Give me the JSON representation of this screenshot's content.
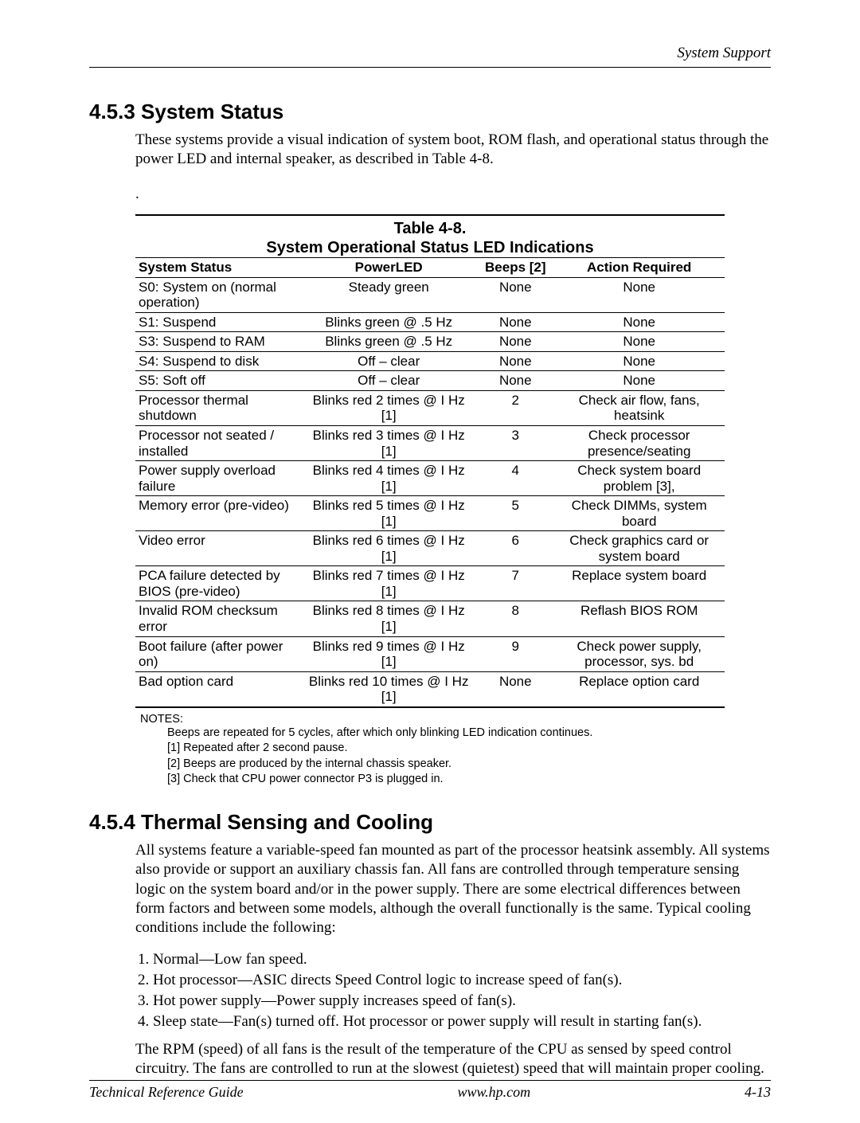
{
  "header": {
    "right": "System Support"
  },
  "section1": {
    "heading": "4.5.3 System Status",
    "para": "These systems provide a visual indication of system boot, ROM flash, and operational status through the power LED and internal speaker, as described in Table 4-8."
  },
  "table": {
    "caption_l1": "Table 4-8.",
    "caption_l2": "System Operational Status LED Indications",
    "headers": {
      "status": "System Status",
      "power": "PowerLED",
      "beeps": "Beeps [2]",
      "action": "Action Required"
    },
    "rows": [
      {
        "status": "S0: System on (normal operation)",
        "power": "Steady green",
        "beeps": "None",
        "action": "None"
      },
      {
        "status": "S1: Suspend",
        "power": "Blinks green @ .5 Hz",
        "beeps": "None",
        "action": "None"
      },
      {
        "status": "S3: Suspend to RAM",
        "power": "Blinks green @ .5 Hz",
        "beeps": "None",
        "action": "None"
      },
      {
        "status": "S4: Suspend to disk",
        "power": "Off – clear",
        "beeps": "None",
        "action": "None"
      },
      {
        "status": "S5: Soft off",
        "power": "Off – clear",
        "beeps": "None",
        "action": "None"
      },
      {
        "status": "Processor thermal shutdown",
        "power": "Blinks red 2 times @ I Hz [1]",
        "beeps": "2",
        "action": "Check air flow, fans, heatsink"
      },
      {
        "status": "Processor not seated / installed",
        "power": "Blinks red 3 times @ I Hz [1]",
        "beeps": "3",
        "action": "Check processor presence/seating"
      },
      {
        "status": "Power supply overload failure",
        "power": "Blinks red 4 times @ I Hz [1]",
        "beeps": "4",
        "action": "Check system board problem [3],"
      },
      {
        "status": "Memory error (pre-video)",
        "power": "Blinks red 5 times @ I Hz [1]",
        "beeps": "5",
        "action": "Check DIMMs, system board"
      },
      {
        "status": "Video error",
        "power": "Blinks red 6 times @ I Hz [1]",
        "beeps": "6",
        "action": "Check graphics card or system board"
      },
      {
        "status": "PCA failure detected by BIOS (pre-video)",
        "power": "Blinks red 7 times @ I Hz [1]",
        "beeps": "7",
        "action": "Replace system board"
      },
      {
        "status": "Invalid ROM checksum error",
        "power": "Blinks red 8 times @ I Hz [1]",
        "beeps": "8",
        "action": "Reflash BIOS ROM"
      },
      {
        "status": "Boot failure (after power on)",
        "power": "Blinks red 9 times @ I Hz [1]",
        "beeps": "9",
        "action": "Check power supply, processor, sys. bd"
      },
      {
        "status": "Bad option card",
        "power": "Blinks red 10 times @ I Hz [1]",
        "beeps": "None",
        "action": "Replace option card"
      }
    ]
  },
  "notes": {
    "label": "NOTES:",
    "lines": [
      "Beeps are repeated for 5 cycles, after which only blinking LED indication continues.",
      "[1] Repeated after 2 second pause.",
      "[2] Beeps are produced by the internal chassis speaker.",
      "[3] Check that CPU power connector P3 is plugged in."
    ]
  },
  "section2": {
    "heading": "4.5.4 Thermal Sensing and Cooling",
    "para1": "All systems feature a variable-speed fan mounted as part of the processor heatsink assembly. All systems also provide or support an auxiliary chassis fan. All fans are controlled through temperature sensing logic on the system board and/or in the power supply. There are some electrical differences between form factors and between some models, although the overall functionally is the same. Typical cooling conditions include the following:",
    "list": [
      "Normal—Low fan speed.",
      "Hot processor—ASIC directs Speed Control logic to increase speed of fan(s).",
      "Hot power supply—Power supply increases speed of fan(s).",
      "Sleep state—Fan(s) turned off. Hot processor or power supply will result in starting fan(s)."
    ],
    "para2": "The RPM (speed) of all fans is the result of the temperature of the CPU as sensed by speed control circuitry. The fans are controlled to run at the slowest (quietest) speed that will maintain proper cooling."
  },
  "footer": {
    "left": "Technical Reference Guide",
    "mid": "www.hp.com",
    "right": "4-13"
  }
}
